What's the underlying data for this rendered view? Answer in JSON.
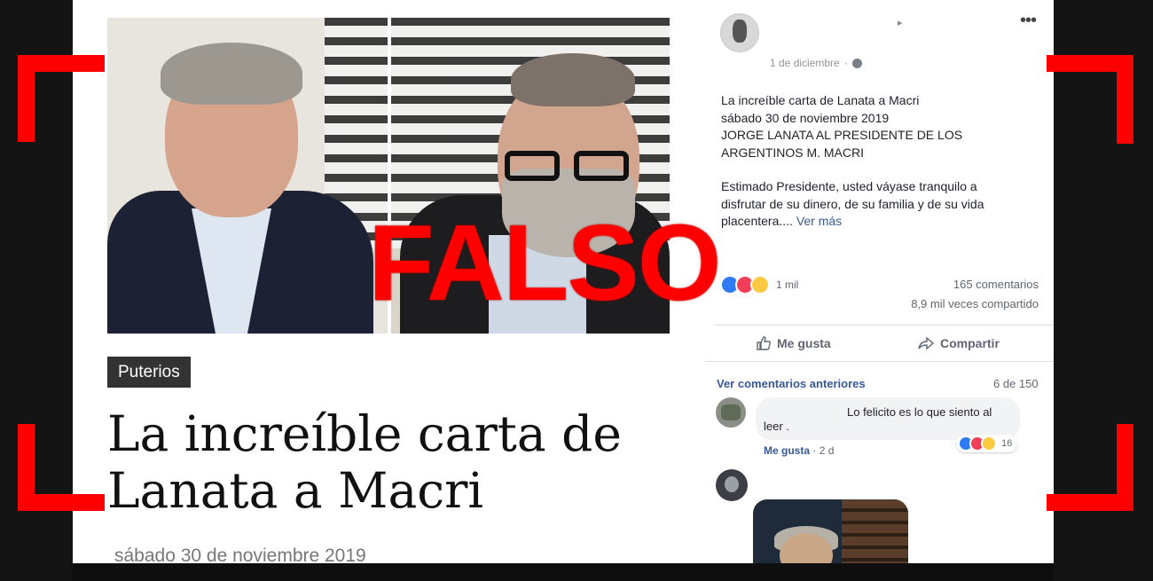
{
  "article": {
    "category": "Puterios",
    "headline_line1": "La increíble carta de",
    "headline_line2": "Lanata a Macri",
    "date": "sábado 30 de noviembre 2019"
  },
  "facebook_post": {
    "timestamp": "1 de diciembre",
    "text_lines": [
      "La increíble carta de Lanata a Macri",
      "sábado 30 de noviembre 2019",
      "JORGE LANATA AL PRESIDENTE DE LOS",
      "ARGENTINOS M. MACRI"
    ],
    "body_lines": [
      "Estimado Presidente, usted váyase tranquilo a",
      "disfrutar de su dinero, de su familia y de su vida",
      "placentera...."
    ],
    "see_more": "Ver más",
    "reactions_count": "1 mil",
    "comments_count": "165 comentarios",
    "shares_count": "8,9 mil veces compartido",
    "like_label": "Me gusta",
    "share_label": "Compartir",
    "previous_comments": "Ver comentarios anteriores",
    "comment_pager": "6 de 150",
    "comment": {
      "text_line1": "Lo felicito es lo que siento al",
      "text_line2": "leer .",
      "reaction_count": "16",
      "like_label": "Me gusta",
      "age": "2 d"
    }
  },
  "overlay": {
    "stamp_text": "FALSO",
    "stamp_color": "#ff0000"
  },
  "icons": [
    "more-options-icon",
    "globe-icon",
    "like-icon",
    "share-icon",
    "like-reaction-icon",
    "love-reaction-icon",
    "haha-reaction-icon"
  ]
}
